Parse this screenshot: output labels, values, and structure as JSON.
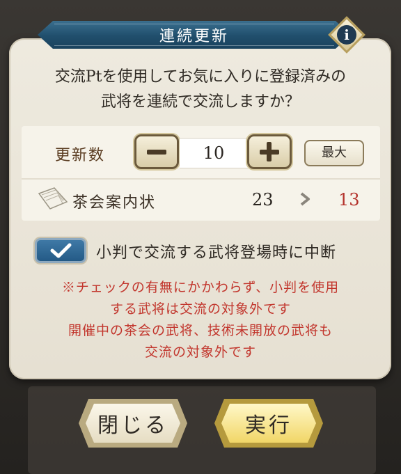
{
  "dialog": {
    "title": "連続更新",
    "info_icon": "i",
    "question_line1": "交流Ptを使用してお気に入りに登録済みの",
    "question_line2": "武将を連続で交流しますか？"
  },
  "count_row": {
    "label": "更新数",
    "value": "10",
    "max_label": "最大"
  },
  "ticket_row": {
    "label": "茶会案内状",
    "from": "23",
    "to": "13"
  },
  "checkbox": {
    "checked": true,
    "label": "小判で交流する武将登場時に中断"
  },
  "warning": {
    "line1": "※チェックの有無にかかわらず、小判を使用",
    "line2": "する武将は交流の対象外です",
    "line3": "開催中の茶会の武将、技術未開放の武将も",
    "line4": "交流の対象外です"
  },
  "buttons": {
    "close_label": "閉じる",
    "execute_label": "実行"
  },
  "colors": {
    "title_banner": "#204e6c",
    "warning_text": "#c2362d",
    "result_number": "#b3312b",
    "checkbox_fill": "#245a86",
    "execute_button": "#f1d667"
  }
}
